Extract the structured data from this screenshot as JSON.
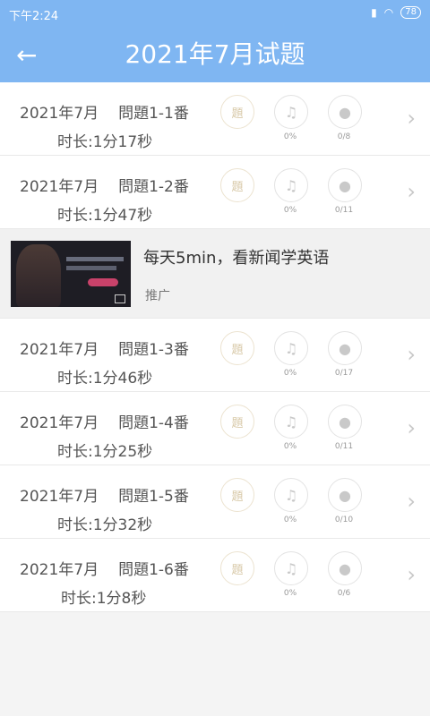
{
  "status_bar": {
    "time": "下午2:24",
    "battery": "78"
  },
  "header": {
    "title": "2021年7月试题"
  },
  "items": [
    {
      "date": "2021年7月",
      "question": "問題1-1番",
      "duration": "时长:1分17秒",
      "sub_icon": "題",
      "listen": "0%",
      "speak": "0/8"
    },
    {
      "date": "2021年7月",
      "question": "問題1-2番",
      "duration": "时长:1分47秒",
      "sub_icon": "題",
      "listen": "0%",
      "speak": "0/11"
    },
    {
      "date": "2021年7月",
      "question": "問題1-3番",
      "duration": "时长:1分46秒",
      "sub_icon": "題",
      "listen": "0%",
      "speak": "0/17"
    },
    {
      "date": "2021年7月",
      "question": "問題1-4番",
      "duration": "时长:1分25秒",
      "sub_icon": "題",
      "listen": "0%",
      "speak": "0/11"
    },
    {
      "date": "2021年7月",
      "question": "問題1-5番",
      "duration": "时长:1分32秒",
      "sub_icon": "題",
      "listen": "0%",
      "speak": "0/10"
    },
    {
      "date": "2021年7月",
      "question": "問題1-6番",
      "duration": "时长:1分8秒",
      "sub_icon": "題",
      "listen": "0%",
      "speak": "0/6"
    }
  ],
  "ad": {
    "title": "每天5min，看新闻学英语",
    "tag": "推广"
  },
  "icons": {
    "back": "arrow-left-icon",
    "listen": "headphones-icon",
    "speak": "microphone-icon",
    "chevron": "chevron-right-icon"
  },
  "colors": {
    "header": "#7fb6f2",
    "background": "#f4f4f4"
  }
}
